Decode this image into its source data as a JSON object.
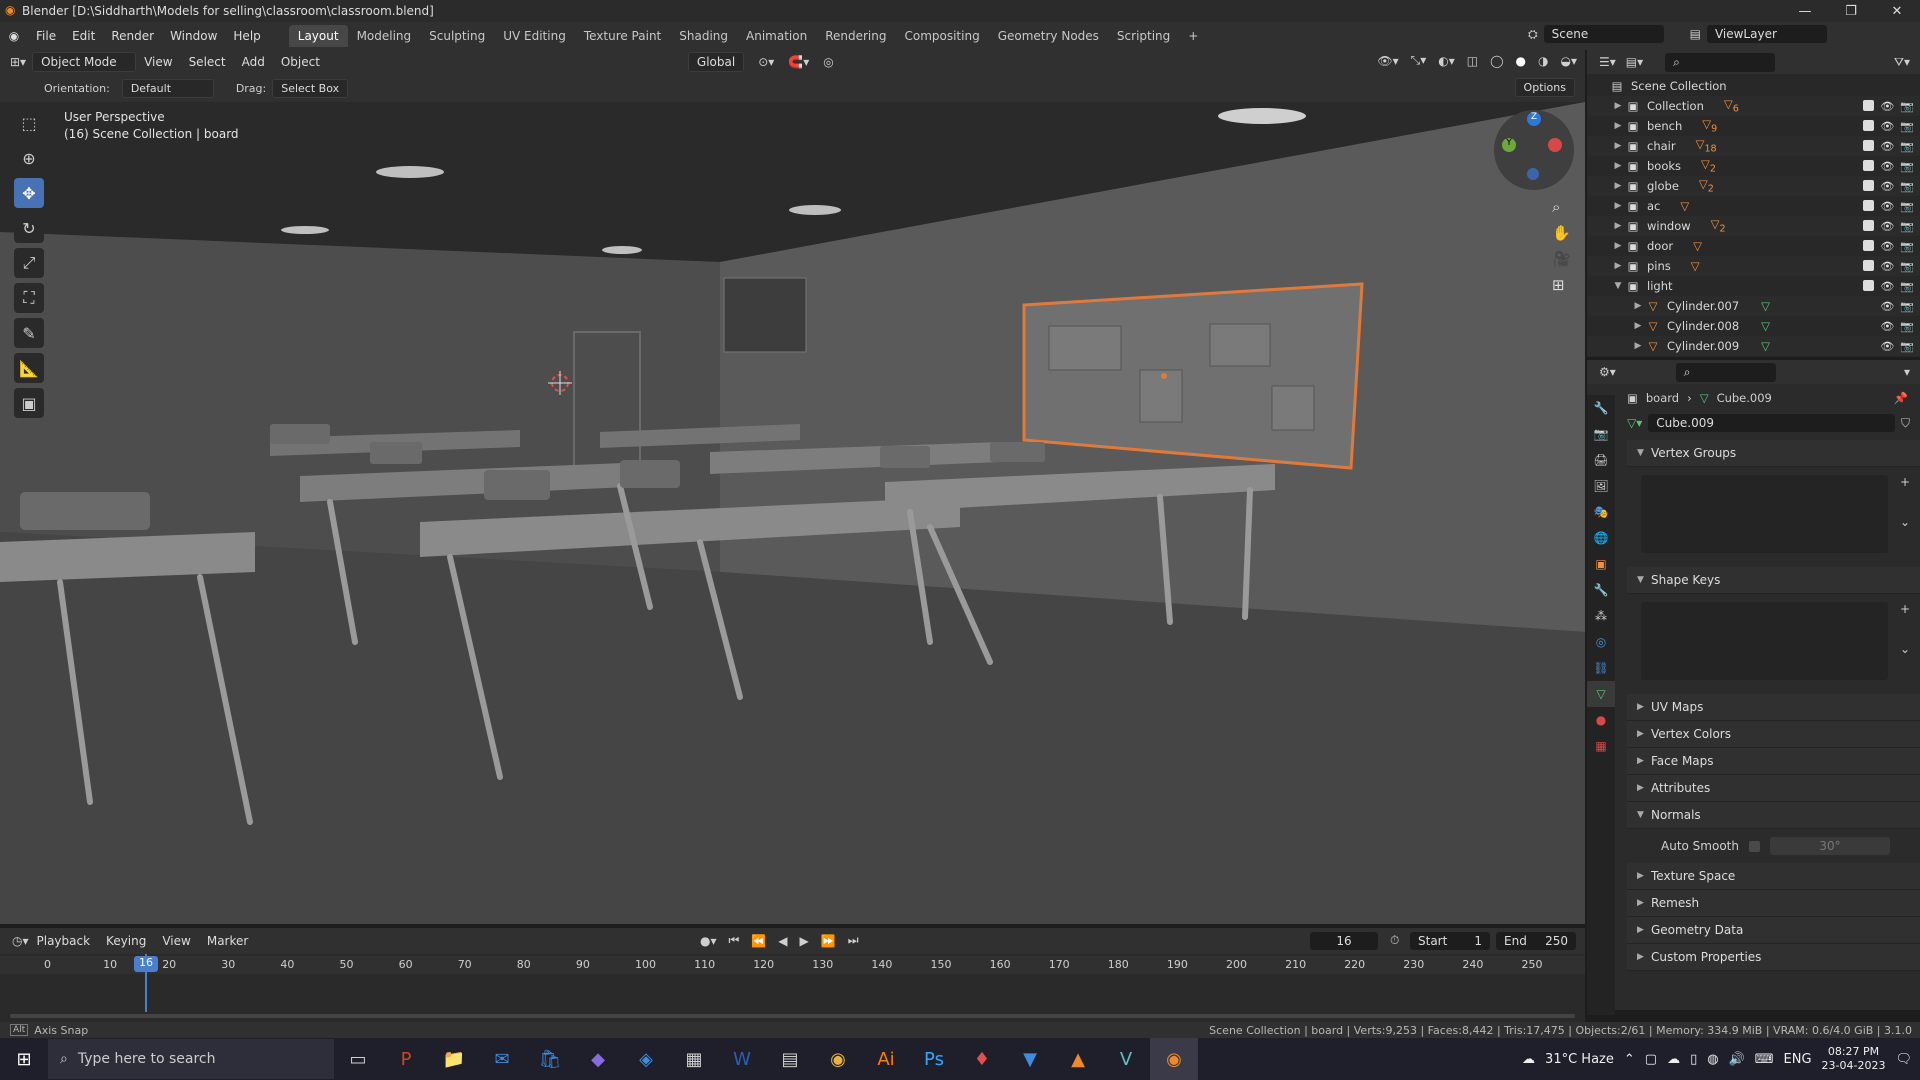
{
  "title_bar": {
    "text": "Blender [D:\\Siddharth\\Models for selling\\classroom\\classroom.blend]"
  },
  "menu": [
    "File",
    "Edit",
    "Render",
    "Window",
    "Help"
  ],
  "workspaces": [
    "Layout",
    "Modeling",
    "Sculpting",
    "UV Editing",
    "Texture Paint",
    "Shading",
    "Animation",
    "Rendering",
    "Compositing",
    "Geometry Nodes",
    "Scripting"
  ],
  "active_workspace": "Layout",
  "scene": {
    "name": "Scene",
    "view_layer": "ViewLayer"
  },
  "viewport_header": {
    "mode": "Object Mode",
    "menus": [
      "View",
      "Select",
      "Add",
      "Object"
    ],
    "transform_orientation": "Global",
    "orientation_label": "Orientation:",
    "orientation_value": "Default",
    "drag_label": "Drag:",
    "drag_value": "Select Box",
    "options": "Options"
  },
  "viewport_info": {
    "line1": "User Perspective",
    "line2": "(16) Scene Collection | board"
  },
  "outliner": {
    "root": "Scene Collection",
    "items": [
      {
        "name": "Collection",
        "badge": "6",
        "expanded": false
      },
      {
        "name": "bench",
        "badge": "9",
        "expanded": false
      },
      {
        "name": "chair",
        "badge": "18",
        "expanded": false
      },
      {
        "name": "books",
        "badge": "2",
        "expanded": false
      },
      {
        "name": "globe",
        "badge": "2",
        "expanded": false
      },
      {
        "name": "ac",
        "badge": "",
        "expanded": false
      },
      {
        "name": "window",
        "badge": "2",
        "expanded": false
      },
      {
        "name": "door",
        "badge": "",
        "expanded": false
      },
      {
        "name": "pins",
        "badge": "",
        "expanded": false
      },
      {
        "name": "light",
        "badge": "",
        "expanded": true
      }
    ],
    "children": [
      "Cylinder.007",
      "Cylinder.008",
      "Cylinder.009"
    ]
  },
  "properties": {
    "breadcrumb_object": "board",
    "breadcrumb_data": "Cube.009",
    "data_name": "Cube.009",
    "sections": [
      {
        "label": "Vertex Groups",
        "open": true
      },
      {
        "label": "Shape Keys",
        "open": true
      },
      {
        "label": "UV Maps",
        "open": false
      },
      {
        "label": "Vertex Colors",
        "open": false
      },
      {
        "label": "Face Maps",
        "open": false
      },
      {
        "label": "Attributes",
        "open": false
      },
      {
        "label": "Normals",
        "open": true
      },
      {
        "label": "Texture Space",
        "open": false
      },
      {
        "label": "Remesh",
        "open": false
      },
      {
        "label": "Geometry Data",
        "open": false
      },
      {
        "label": "Custom Properties",
        "open": false
      }
    ],
    "auto_smooth_label": "Auto Smooth",
    "auto_smooth_angle": "30°"
  },
  "timeline": {
    "menus": [
      "Playback",
      "Keying",
      "View",
      "Marker"
    ],
    "current_frame": "16",
    "start_label": "Start",
    "start": "1",
    "end_label": "End",
    "end": "250",
    "ticks": [
      "0",
      "10",
      "20",
      "30",
      "40",
      "50",
      "60",
      "70",
      "80",
      "90",
      "100",
      "110",
      "120",
      "130",
      "140",
      "150",
      "160",
      "170",
      "180",
      "190",
      "200",
      "210",
      "220",
      "230",
      "240",
      "250"
    ]
  },
  "status_bar": {
    "left": "Axis Snap",
    "right": "Scene Collection | board | Verts:9,253 | Faces:8,442 | Tris:17,475 | Objects:2/61 | Memory: 334.9 MiB | VRAM: 0.6/4.0 GiB | 3.1.0"
  },
  "taskbar": {
    "search_placeholder": "Type here to search",
    "weather": "31°C  Haze",
    "lang": "ENG",
    "time": "08:27 PM",
    "date": "23-04-2023"
  }
}
